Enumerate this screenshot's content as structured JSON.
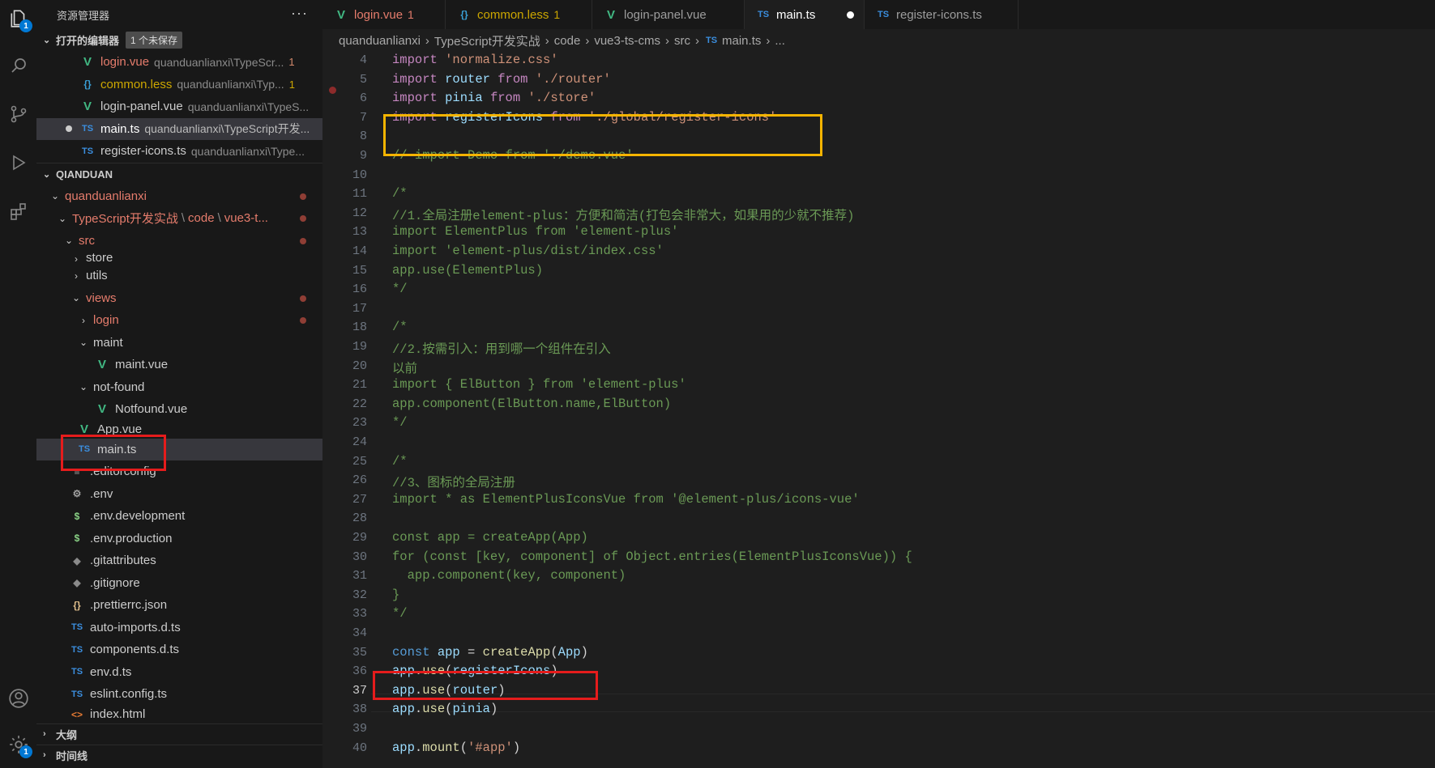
{
  "sidebar": {
    "title": "资源管理器",
    "more": "···",
    "open_editors": {
      "label": "打开的编辑器",
      "unsaved": "1 个未保存",
      "items": [
        {
          "name": "login.vue",
          "path": "quanduanlianxi\\TypeScr...",
          "count": "1",
          "icon": "vue-icon"
        },
        {
          "name": "common.less",
          "path": "quanduanlianxi\\Typ...",
          "count": "1",
          "icon": "less-icon"
        },
        {
          "name": "login-panel.vue",
          "path": "quanduanlianxi\\TypeS...",
          "icon": "vue-icon"
        },
        {
          "name": "main.ts",
          "path": "quanduanlianxi\\TypeScript开发...",
          "icon": "ts-icon"
        },
        {
          "name": "register-icons.ts",
          "path": "quanduanlianxi\\Type...",
          "icon": "ts-icon"
        }
      ]
    },
    "workspace": {
      "label": "QIANDUAN",
      "tree": [
        {
          "label": "quanduanlianxi"
        },
        {
          "label": "TypeScript开发实战",
          "rest": "code",
          "rest2": "vue3-t..."
        },
        {
          "label": "src"
        },
        {
          "label": "store"
        },
        {
          "label": "utils"
        },
        {
          "label": "views"
        },
        {
          "label": "login"
        },
        {
          "label": "maint"
        },
        {
          "label": "maint.vue"
        },
        {
          "label": "not-found"
        },
        {
          "label": "Notfound.vue"
        },
        {
          "label": "App.vue"
        },
        {
          "label": "main.ts"
        },
        {
          "label": ".editorconfig"
        },
        {
          "label": ".env"
        },
        {
          "label": ".env.development"
        },
        {
          "label": ".env.production"
        },
        {
          "label": ".gitattributes"
        },
        {
          "label": ".gitignore"
        },
        {
          "label": ".prettierrc.json"
        },
        {
          "label": "auto-imports.d.ts"
        },
        {
          "label": "components.d.ts"
        },
        {
          "label": "env.d.ts"
        },
        {
          "label": "eslint.config.ts"
        },
        {
          "label": "index.html"
        }
      ]
    },
    "outline_label": "大纲",
    "timeline_label": "时间线"
  },
  "activity": {
    "explorer_badge": "1",
    "settings_badge": "1"
  },
  "tabs": [
    {
      "label": "login.vue",
      "count": "1",
      "icon": "V"
    },
    {
      "label": "common.less",
      "count": "1",
      "icon": "{}"
    },
    {
      "label": "login-panel.vue",
      "icon": "V"
    },
    {
      "label": "main.ts",
      "icon": "TS"
    },
    {
      "label": "register-icons.ts",
      "icon": "TS"
    }
  ],
  "breadcrumbs": [
    "quanduanlianxi",
    "TypeScript开发实战",
    "code",
    "vue3-ts-cms",
    "src",
    "main.ts",
    "..."
  ],
  "editor": {
    "lines": [
      {
        "n": "4",
        "parts": [
          [
            "kw",
            "import "
          ],
          [
            "str",
            "'normalize.css'"
          ]
        ]
      },
      {
        "n": "5",
        "parts": [
          [
            "kw",
            "import "
          ],
          [
            "var",
            "router "
          ],
          [
            "kw",
            "from "
          ],
          [
            "str",
            "'./router'"
          ]
        ]
      },
      {
        "n": "6",
        "parts": [
          [
            "kw",
            "import "
          ],
          [
            "var",
            "pinia "
          ],
          [
            "kw",
            "from "
          ],
          [
            "str",
            "'./store'"
          ]
        ]
      },
      {
        "n": "7",
        "parts": [
          [
            "kw",
            "import "
          ],
          [
            "var",
            "registerIcons "
          ],
          [
            "kw",
            "from "
          ],
          [
            "str",
            "'./global/register-icons'"
          ]
        ]
      },
      {
        "n": "8",
        "parts": []
      },
      {
        "n": "9",
        "parts": [
          [
            "cm",
            "// import Demo from './demo.vue'"
          ]
        ]
      },
      {
        "n": "10",
        "parts": []
      },
      {
        "n": "11",
        "parts": [
          [
            "cm",
            "/*"
          ]
        ]
      },
      {
        "n": "12",
        "parts": [
          [
            "cm",
            "//1.全局注册element-plus：方便和简洁(打包会非常大，如果用的少就不推荐)"
          ]
        ]
      },
      {
        "n": "13",
        "parts": [
          [
            "cm",
            "import ElementPlus from 'element-plus'"
          ]
        ]
      },
      {
        "n": "14",
        "parts": [
          [
            "cm",
            "import 'element-plus/dist/index.css'"
          ]
        ]
      },
      {
        "n": "15",
        "parts": [
          [
            "cm",
            "app.use(ElementPlus)"
          ]
        ]
      },
      {
        "n": "16",
        "parts": [
          [
            "cm",
            "*/"
          ]
        ]
      },
      {
        "n": "17",
        "parts": []
      },
      {
        "n": "18",
        "parts": [
          [
            "cm",
            "/*"
          ]
        ]
      },
      {
        "n": "19",
        "parts": [
          [
            "cm",
            "//2.按需引入：用到哪一个组件在引入"
          ]
        ]
      },
      {
        "n": "20",
        "parts": [
          [
            "cm",
            "以前"
          ]
        ]
      },
      {
        "n": "21",
        "parts": [
          [
            "cm",
            "import { ElButton } from 'element-plus'"
          ]
        ]
      },
      {
        "n": "22",
        "parts": [
          [
            "cm",
            "app.component(ElButton.name,ElButton)"
          ]
        ]
      },
      {
        "n": "23",
        "parts": [
          [
            "cm",
            "*/"
          ]
        ]
      },
      {
        "n": "24",
        "parts": []
      },
      {
        "n": "25",
        "parts": [
          [
            "cm",
            "/*"
          ]
        ]
      },
      {
        "n": "26",
        "parts": [
          [
            "cm",
            "//3、图标的全局注册"
          ]
        ]
      },
      {
        "n": "27",
        "parts": [
          [
            "cm",
            "import * as ElementPlusIconsVue from '@element-plus/icons-vue'"
          ]
        ]
      },
      {
        "n": "28",
        "parts": []
      },
      {
        "n": "29",
        "parts": [
          [
            "cm",
            "const app = createApp(App)"
          ]
        ]
      },
      {
        "n": "30",
        "parts": [
          [
            "cm",
            "for (const [key, component] of Object.entries(ElementPlusIconsVue)) {"
          ]
        ]
      },
      {
        "n": "31",
        "parts": [
          [
            "cm",
            "  app.component(key, component)"
          ]
        ]
      },
      {
        "n": "32",
        "parts": [
          [
            "cm",
            "}"
          ]
        ]
      },
      {
        "n": "33",
        "parts": [
          [
            "cm",
            "*/"
          ]
        ]
      },
      {
        "n": "34",
        "parts": []
      },
      {
        "n": "35",
        "parts": [
          [
            "bl",
            "const "
          ],
          [
            "var",
            "app "
          ],
          [
            "plain",
            "= "
          ],
          [
            "fn",
            "createApp"
          ],
          [
            "plain",
            "("
          ],
          [
            "var",
            "App"
          ],
          [
            "plain",
            ")"
          ]
        ]
      },
      {
        "n": "36",
        "parts": [
          [
            "var",
            "app"
          ],
          [
            "plain",
            "."
          ],
          [
            "fn",
            "use"
          ],
          [
            "plain",
            "("
          ],
          [
            "var",
            "registerIcons"
          ],
          [
            "plain",
            ")"
          ]
        ]
      },
      {
        "n": "37",
        "parts": [
          [
            "var",
            "app"
          ],
          [
            "plain",
            "."
          ],
          [
            "fn",
            "use"
          ],
          [
            "plain",
            "("
          ],
          [
            "var",
            "router"
          ],
          [
            "plain",
            ")"
          ]
        ]
      },
      {
        "n": "38",
        "parts": [
          [
            "var",
            "app"
          ],
          [
            "plain",
            "."
          ],
          [
            "fn",
            "use"
          ],
          [
            "plain",
            "("
          ],
          [
            "var",
            "pinia"
          ],
          [
            "plain",
            ")"
          ]
        ]
      },
      {
        "n": "39",
        "parts": []
      },
      {
        "n": "40",
        "parts": [
          [
            "var",
            "app"
          ],
          [
            "plain",
            "."
          ],
          [
            "fn",
            "mount"
          ],
          [
            "plain",
            "("
          ],
          [
            "str",
            "'#app'"
          ],
          [
            "plain",
            ")"
          ]
        ]
      }
    ]
  },
  "colors": {
    "highlight_yellow": "#f5b400",
    "highlight_red": "#e51c1c",
    "accent": "#0078d4"
  }
}
